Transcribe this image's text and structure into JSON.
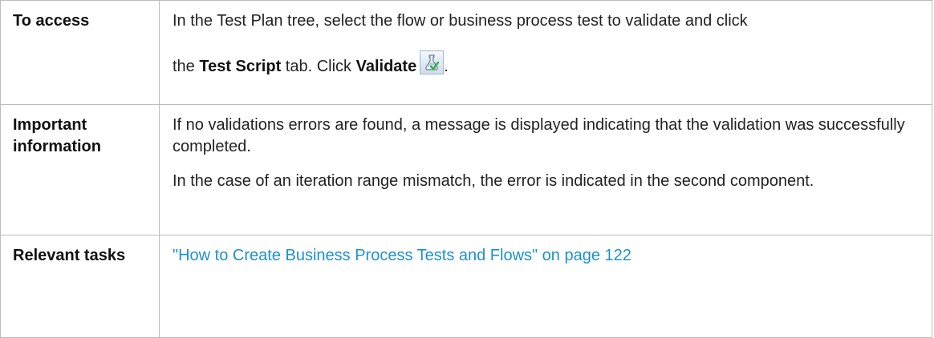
{
  "rows": [
    {
      "label": "To access",
      "line1": "In the Test Plan tree, select the flow or business process test to validate and click",
      "line2_prefix": "the ",
      "line2_bold1": "Test Script",
      "line2_mid": " tab. Click ",
      "line2_bold2": "Validate",
      "line2_suffix": ".",
      "icon": "validate-icon"
    },
    {
      "label": "Important information",
      "para1": "If no validations errors are found, a message is displayed indicating that the validation was successfully completed.",
      "para2": "In the case of an iteration range mismatch, the error is indicated in the second component."
    },
    {
      "label": "Relevant tasks",
      "link": "\"How to Create Business Process Tests and Flows\" on page 122"
    }
  ],
  "colors": {
    "link": "#1d8fd2",
    "border": "#bdbdbd"
  }
}
